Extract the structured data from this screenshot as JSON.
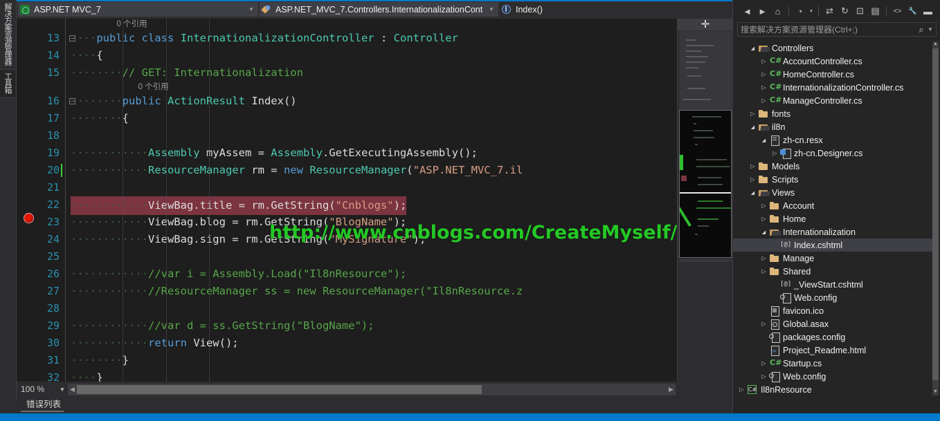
{
  "left_tabs": [
    {
      "label": "解决方案资源管理器",
      "name": "solution-explorer"
    },
    {
      "label": "工具箱",
      "name": "toolbox"
    }
  ],
  "nav_bar": {
    "project": "ASP.NET MVC_7",
    "class": "ASP.NET_MVC_7.Controllers.InternationalizationCont",
    "member": "Index()"
  },
  "editor": {
    "zoom": "100 %",
    "codelens_text": "0 个引用",
    "watermark": "http://www.cnblogs.com/CreateMyself/",
    "lines": [
      {
        "n": "13",
        "codelens": "0 个引用",
        "fold": "−",
        "indent": 8,
        "tokens": [
          [
            "dot",
            "····"
          ],
          [
            "k",
            "public"
          ],
          [
            "p",
            " "
          ],
          [
            "k",
            "class"
          ],
          [
            "p",
            " "
          ],
          [
            "t",
            "InternationalizationController"
          ],
          [
            "p",
            " : "
          ],
          [
            "t",
            "Controller"
          ]
        ]
      },
      {
        "n": "14",
        "indent": 8,
        "tokens": [
          [
            "dot",
            "····"
          ],
          [
            "p",
            "{"
          ]
        ]
      },
      {
        "n": "15",
        "indent": 12,
        "tokens": [
          [
            "dot",
            "········"
          ],
          [
            "c",
            "// GET: Internationalization"
          ]
        ]
      },
      {
        "n": "16",
        "codelens": "0 个引用",
        "fold": "−",
        "indent": 12,
        "tokens": [
          [
            "dot",
            "········"
          ],
          [
            "k",
            "public"
          ],
          [
            "p",
            " "
          ],
          [
            "t",
            "ActionResult"
          ],
          [
            "p",
            " Index()"
          ]
        ]
      },
      {
        "n": "17",
        "indent": 12,
        "tokens": [
          [
            "dot",
            "········"
          ],
          [
            "p",
            "{"
          ]
        ]
      },
      {
        "n": "18",
        "indent": 12,
        "tokens": []
      },
      {
        "n": "19",
        "indent": 16,
        "tokens": [
          [
            "dot",
            "············"
          ],
          [
            "t",
            "Assembly"
          ],
          [
            "p",
            " myAssem = "
          ],
          [
            "t",
            "Assembly"
          ],
          [
            "p",
            ".GetExecutingAssembly();"
          ]
        ]
      },
      {
        "n": "20",
        "indent": 16,
        "caret": true,
        "tokens": [
          [
            "dot",
            "············"
          ],
          [
            "t",
            "ResourceManager"
          ],
          [
            "p",
            " rm = "
          ],
          [
            "k",
            "new"
          ],
          [
            "p",
            " "
          ],
          [
            "t",
            "ResourceManager"
          ],
          [
            "p",
            "("
          ],
          [
            "s",
            "\"ASP.NET_MVC_7.il"
          ]
        ]
      },
      {
        "n": "21",
        "indent": 16,
        "tokens": []
      },
      {
        "n": "22",
        "indent": 16,
        "highlight": true,
        "tokens": [
          [
            "dot",
            "············"
          ],
          [
            "p",
            "ViewBag.title = rm.GetString("
          ],
          [
            "s",
            "\"Cnblogs\""
          ],
          [
            "p",
            ");"
          ]
        ]
      },
      {
        "n": "23",
        "indent": 16,
        "tokens": [
          [
            "dot",
            "············"
          ],
          [
            "p",
            "ViewBag.blog = rm.GetString("
          ],
          [
            "s",
            "\"BlogName\""
          ],
          [
            "p",
            ");"
          ]
        ]
      },
      {
        "n": "24",
        "indent": 16,
        "tokens": [
          [
            "dot",
            "············"
          ],
          [
            "p",
            "ViewBag.sign = rm.GetString("
          ],
          [
            "s",
            "\"MySignature\""
          ],
          [
            "p",
            ");"
          ]
        ]
      },
      {
        "n": "25",
        "indent": 16,
        "tokens": []
      },
      {
        "n": "26",
        "indent": 16,
        "tokens": [
          [
            "dot",
            "············"
          ],
          [
            "c",
            "//var i = Assembly.Load(\"Il8nResource\");"
          ]
        ]
      },
      {
        "n": "27",
        "indent": 16,
        "tokens": [
          [
            "dot",
            "············"
          ],
          [
            "c",
            "//ResourceManager ss = new ResourceManager(\"Il8nResource.z"
          ]
        ]
      },
      {
        "n": "28",
        "indent": 16,
        "tokens": []
      },
      {
        "n": "29",
        "indent": 16,
        "tokens": [
          [
            "dot",
            "············"
          ],
          [
            "c",
            "//var d = ss.GetString(\"BlogName\");"
          ]
        ]
      },
      {
        "n": "30",
        "indent": 16,
        "tokens": [
          [
            "dot",
            "············"
          ],
          [
            "k",
            "return"
          ],
          [
            "p",
            " View();"
          ]
        ]
      },
      {
        "n": "31",
        "indent": 12,
        "tokens": [
          [
            "dot",
            "········"
          ],
          [
            "p",
            "}"
          ]
        ]
      },
      {
        "n": "32",
        "indent": 8,
        "tokens": [
          [
            "dot",
            "····"
          ],
          [
            "p",
            "}"
          ]
        ]
      }
    ]
  },
  "error_list": {
    "tab_label": "错误列表"
  },
  "solution_explorer": {
    "toolbar_icons": [
      {
        "name": "back-icon",
        "glyph": "◄"
      },
      {
        "name": "forward-icon",
        "glyph": "►"
      },
      {
        "name": "home-icon",
        "glyph": "⌂"
      },
      {
        "name": "pending-changes-icon",
        "glyph": "◔"
      },
      {
        "name": "pending-changes-dropdown-icon",
        "glyph": "▾"
      },
      {
        "name": "sync-icon",
        "glyph": "⇄"
      },
      {
        "name": "refresh-icon",
        "glyph": "↻"
      },
      {
        "name": "collapse-all-icon",
        "glyph": "⊡"
      },
      {
        "name": "properties-icon",
        "glyph": "▤"
      },
      {
        "name": "show-all-files-icon",
        "glyph": "<>"
      },
      {
        "name": "wrench-icon",
        "glyph": "🔧"
      },
      {
        "name": "preview-selected-icon",
        "glyph": "▬"
      }
    ],
    "search_placeholder": "搜索解决方案资源管理器(Ctrl+;)",
    "tree": [
      {
        "label": "Controllers",
        "indent": 2,
        "twist": "open",
        "icon": "folder-open"
      },
      {
        "label": "AccountController.cs",
        "indent": 3,
        "twist": "closed",
        "icon": "cs"
      },
      {
        "label": "HomeController.cs",
        "indent": 3,
        "twist": "closed",
        "icon": "cs"
      },
      {
        "label": "InternationalizationController.cs",
        "indent": 3,
        "twist": "closed",
        "icon": "cs"
      },
      {
        "label": "ManageController.cs",
        "indent": 3,
        "twist": "closed",
        "icon": "cs"
      },
      {
        "label": "fonts",
        "indent": 2,
        "twist": "closed",
        "icon": "folder"
      },
      {
        "label": "il8n",
        "indent": 2,
        "twist": "open",
        "icon": "folder-open"
      },
      {
        "label": "zh-cn.resx",
        "indent": 3,
        "twist": "open",
        "icon": "resx"
      },
      {
        "label": "zh-cn.Designer.cs",
        "indent": 4,
        "twist": "closed",
        "icon": "designer"
      },
      {
        "label": "Models",
        "indent": 2,
        "twist": "closed",
        "icon": "folder"
      },
      {
        "label": "Scripts",
        "indent": 2,
        "twist": "closed",
        "icon": "folder"
      },
      {
        "label": "Views",
        "indent": 2,
        "twist": "open",
        "icon": "folder-open"
      },
      {
        "label": "Account",
        "indent": 3,
        "twist": "closed",
        "icon": "folder"
      },
      {
        "label": "Home",
        "indent": 3,
        "twist": "closed",
        "icon": "folder"
      },
      {
        "label": "Internationalization",
        "indent": 3,
        "twist": "open",
        "icon": "folder-open"
      },
      {
        "label": "Index.cshtml",
        "indent": 4,
        "twist": "none",
        "icon": "cshtml",
        "selected": true
      },
      {
        "label": "Manage",
        "indent": 3,
        "twist": "closed",
        "icon": "folder"
      },
      {
        "label": "Shared",
        "indent": 3,
        "twist": "closed",
        "icon": "folder"
      },
      {
        "label": "_ViewStart.cshtml",
        "indent": 4,
        "twist": "none",
        "icon": "cshtml"
      },
      {
        "label": "Web.config",
        "indent": 4,
        "twist": "none",
        "icon": "config"
      },
      {
        "label": "favicon.ico",
        "indent": 3,
        "twist": "none",
        "icon": "ico"
      },
      {
        "label": "Global.asax",
        "indent": 3,
        "twist": "closed",
        "icon": "asax"
      },
      {
        "label": "packages.config",
        "indent": 3,
        "twist": "none",
        "icon": "config"
      },
      {
        "label": "Project_Readme.html",
        "indent": 3,
        "twist": "none",
        "icon": "html"
      },
      {
        "label": "Startup.cs",
        "indent": 3,
        "twist": "closed",
        "icon": "cs"
      },
      {
        "label": "Web.config",
        "indent": 3,
        "twist": "closed",
        "icon": "config"
      },
      {
        "label": "Il8nResource",
        "indent": 1,
        "twist": "closed",
        "icon": "csproj"
      }
    ]
  },
  "colors": {
    "accent": "#007acc",
    "editor_bg": "#1e1e1e",
    "chrome_bg": "#2d2d30",
    "panel_bg": "#252526",
    "keyword": "#569cd6",
    "type": "#4ec9b0",
    "string": "#d69d85",
    "comment": "#57a64a",
    "linenumber": "#2b91af",
    "breakpoint": "#e51400",
    "highlight_line": "#7c3440",
    "watermark": "#25c825"
  }
}
